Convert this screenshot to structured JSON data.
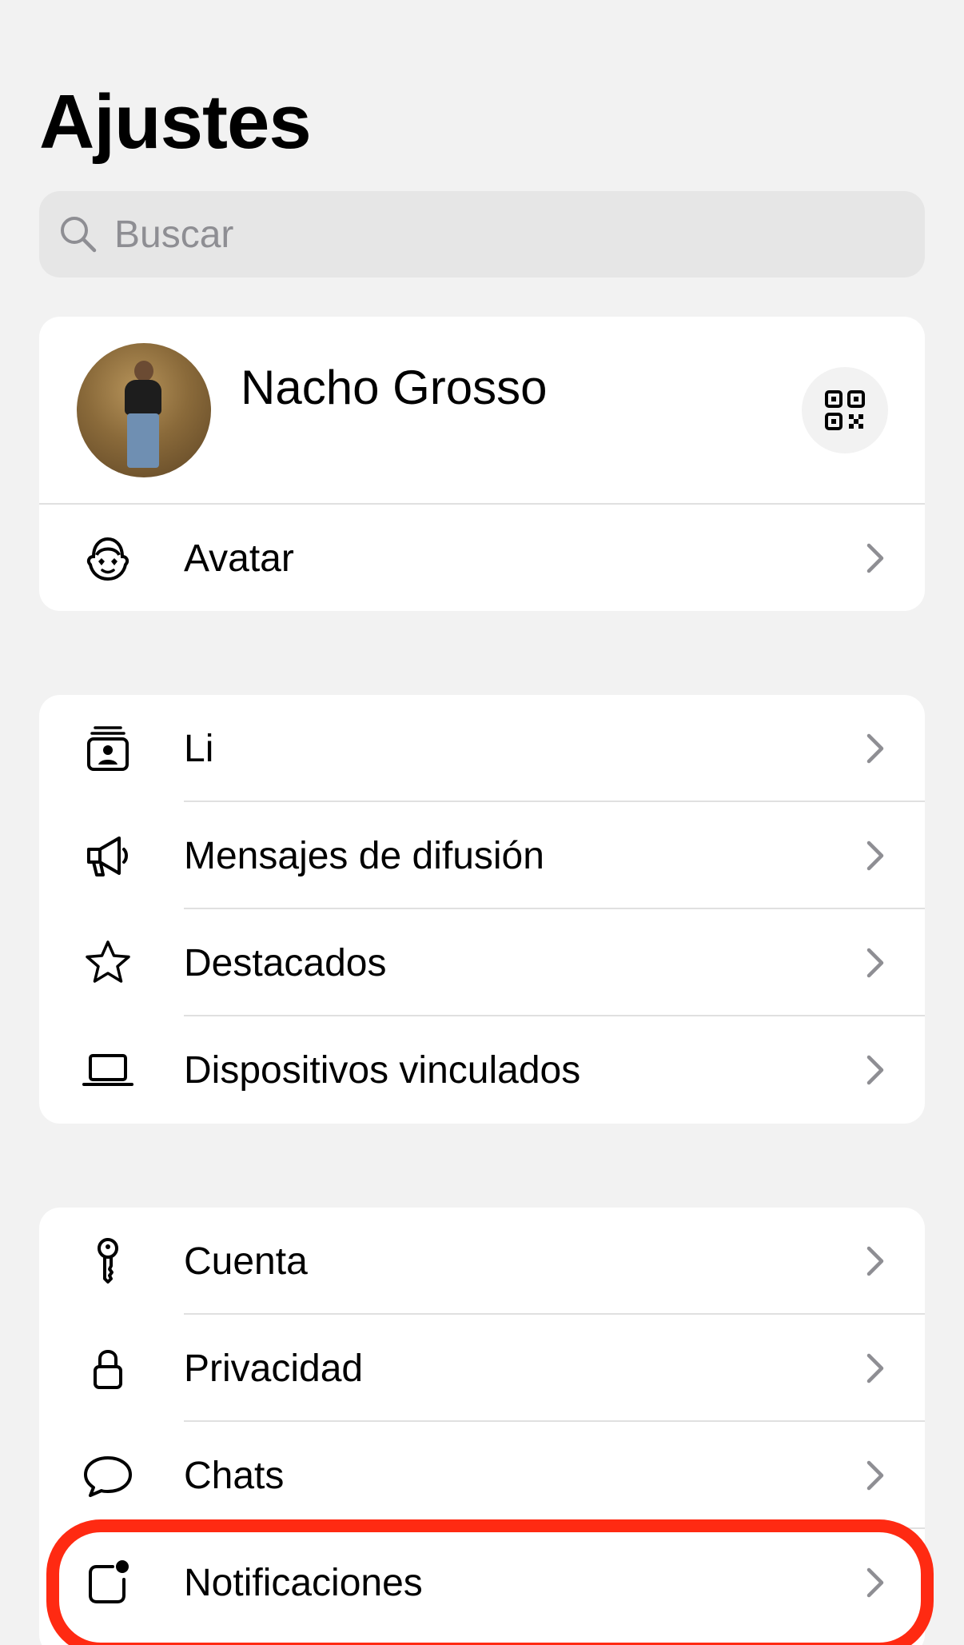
{
  "header": {
    "title": "Ajustes"
  },
  "search": {
    "placeholder": "Buscar"
  },
  "profile": {
    "name": "Nacho Grosso"
  },
  "avatar_row": {
    "label": "Avatar"
  },
  "tools": [
    {
      "label": "Li",
      "icon": "lists-icon"
    },
    {
      "label": "Mensajes de difusión",
      "icon": "megaphone-icon"
    },
    {
      "label": "Destacados",
      "icon": "star-icon"
    },
    {
      "label": "Dispositivos vinculados",
      "icon": "laptop-icon"
    }
  ],
  "settings": [
    {
      "label": "Cuenta",
      "icon": "key-icon"
    },
    {
      "label": "Privacidad",
      "icon": "lock-icon"
    },
    {
      "label": "Chats",
      "icon": "chat-bubble-icon"
    },
    {
      "label": "Notificaciones",
      "icon": "notification-icon"
    }
  ],
  "colors": {
    "highlight": "#ff2a12",
    "background": "#f2f2f2",
    "card": "#ffffff"
  }
}
